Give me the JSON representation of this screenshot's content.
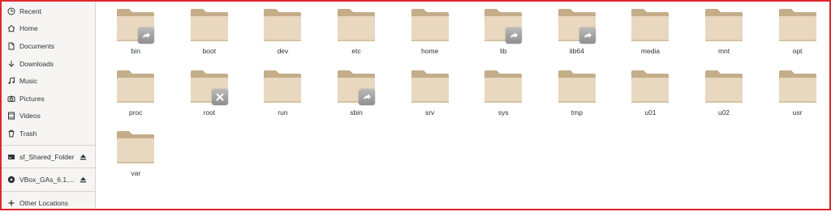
{
  "sidebar": {
    "items": [
      {
        "label": "Recent",
        "icon": "clock-icon"
      },
      {
        "label": "Home",
        "icon": "home-icon"
      },
      {
        "label": "Documents",
        "icon": "document-icon"
      },
      {
        "label": "Downloads",
        "icon": "download-icon"
      },
      {
        "label": "Music",
        "icon": "music-icon"
      },
      {
        "label": "Pictures",
        "icon": "camera-icon"
      },
      {
        "label": "Videos",
        "icon": "film-icon"
      },
      {
        "label": "Trash",
        "icon": "trash-icon"
      },
      {
        "label": "sf_Shared_Folder",
        "icon": "drive-icon"
      },
      {
        "label": "VBox_GAs_6.1....",
        "icon": "disc-icon"
      },
      {
        "label": "Other Locations",
        "icon": "plus-icon"
      }
    ]
  },
  "folders": [
    {
      "name": "bin",
      "emblem": "link"
    },
    {
      "name": "boot",
      "emblem": ""
    },
    {
      "name": "dev",
      "emblem": ""
    },
    {
      "name": "etc",
      "emblem": ""
    },
    {
      "name": "home",
      "emblem": ""
    },
    {
      "name": "lib",
      "emblem": "link"
    },
    {
      "name": "lib64",
      "emblem": "link"
    },
    {
      "name": "media",
      "emblem": ""
    },
    {
      "name": "mnt",
      "emblem": ""
    },
    {
      "name": "opt",
      "emblem": ""
    },
    {
      "name": "proc",
      "emblem": ""
    },
    {
      "name": "root",
      "emblem": "locked"
    },
    {
      "name": "run",
      "emblem": ""
    },
    {
      "name": "sbin",
      "emblem": "link"
    },
    {
      "name": "srv",
      "emblem": ""
    },
    {
      "name": "sys",
      "emblem": ""
    },
    {
      "name": "tmp",
      "emblem": ""
    },
    {
      "name": "u01",
      "emblem": ""
    },
    {
      "name": "u02",
      "emblem": ""
    },
    {
      "name": "usr",
      "emblem": ""
    },
    {
      "name": "var",
      "emblem": ""
    }
  ],
  "colors": {
    "folder_body": "#e8d8bf",
    "folder_back": "#c4ad89",
    "frame": "#e0262b"
  }
}
